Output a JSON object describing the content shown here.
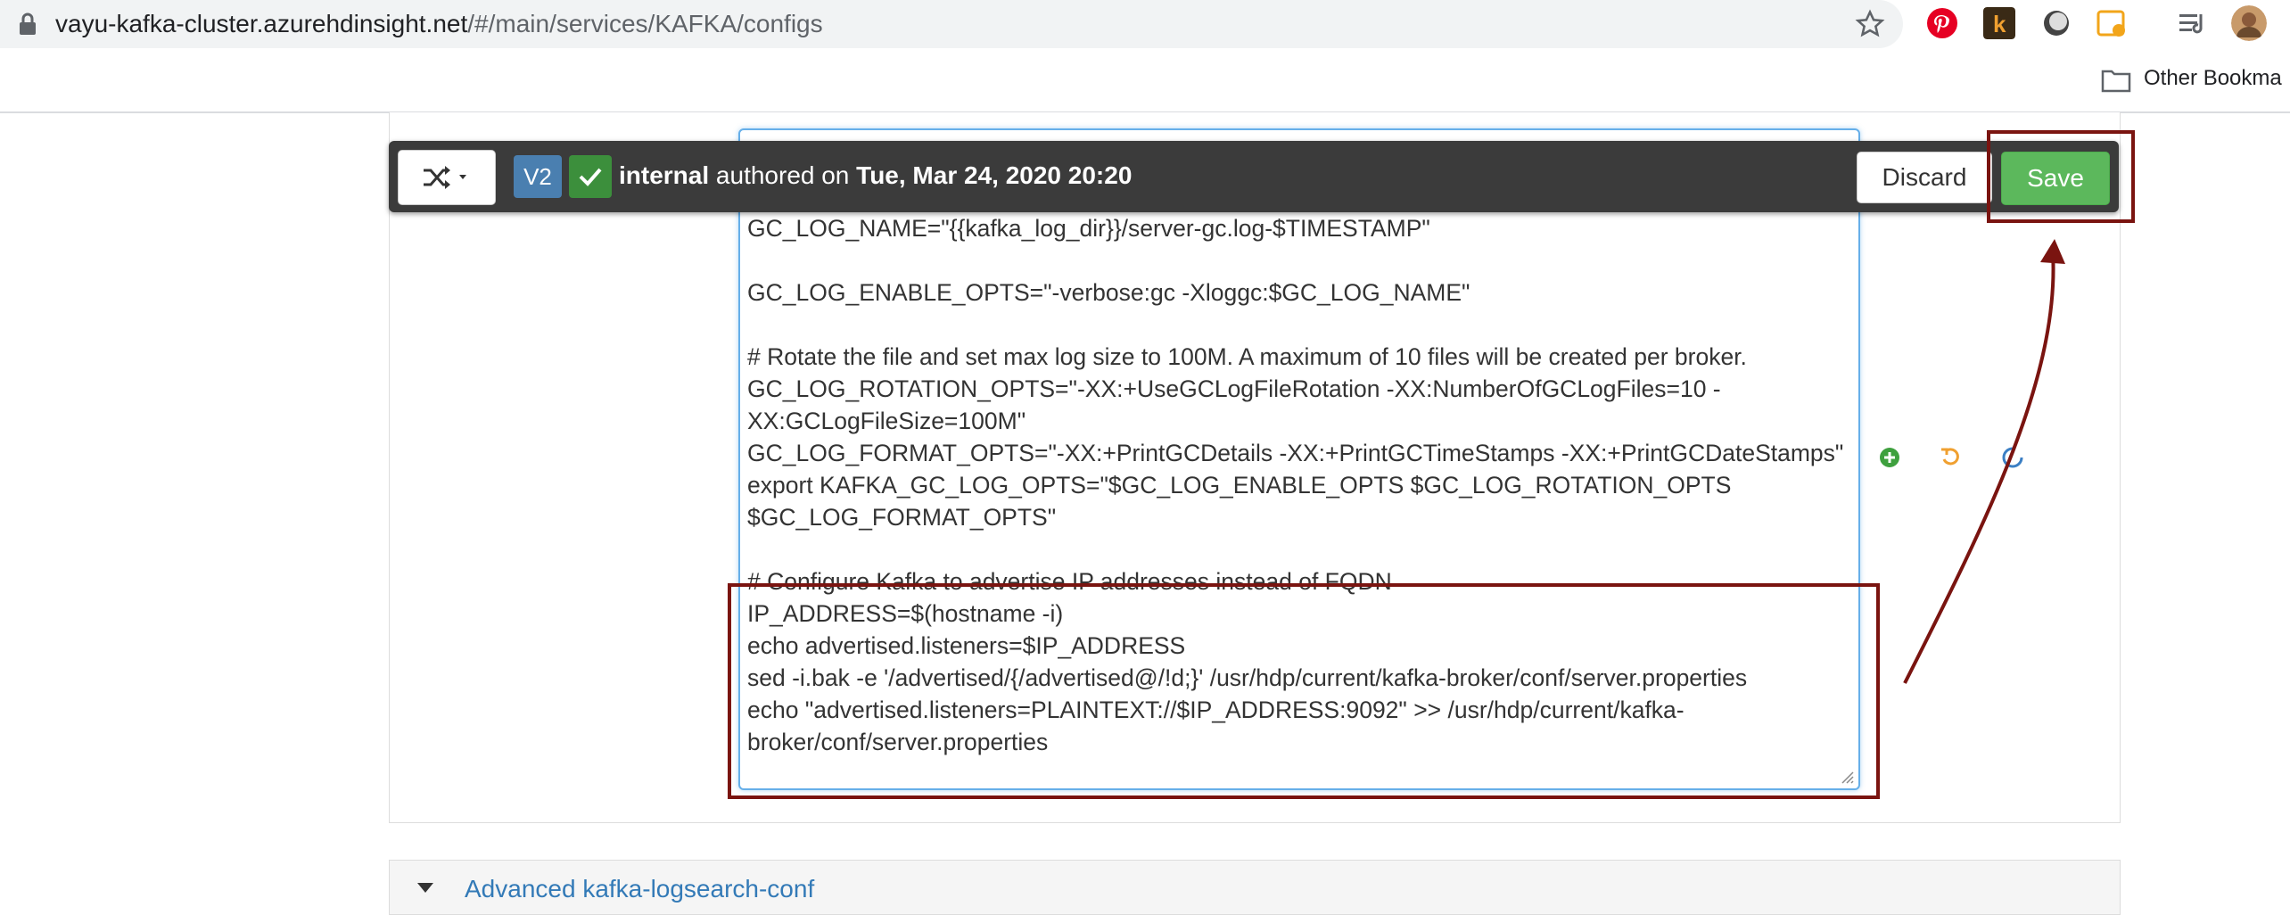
{
  "browser": {
    "url_host": "vayu-kafka-cluster.azurehdinsight.net",
    "url_path": "/#/main/services/KAFKA/configs",
    "bookmark_folder": "Other Bookma"
  },
  "toolbar": {
    "version_badge": "V2",
    "author": "internal",
    "authored_text": "authored on",
    "date": "Tue, Mar 24, 2020 20:20",
    "discard_label": "Discard",
    "save_label": "Save"
  },
  "editor": {
    "lines": [
      "GC_LOG_NAME=\"{{kafka_log_dir}}/server-gc.log-$TIMESTAMP\"",
      "",
      "GC_LOG_ENABLE_OPTS=\"-verbose:gc -Xloggc:$GC_LOG_NAME\"",
      "",
      "# Rotate the file and set max log size to 100M. A maximum of 10 files will be created per broker.",
      "GC_LOG_ROTATION_OPTS=\"-XX:+UseGCLogFileRotation -XX:NumberOfGCLogFiles=10 -XX:GCLogFileSize=100M\"",
      "GC_LOG_FORMAT_OPTS=\"-XX:+PrintGCDetails -XX:+PrintGCTimeStamps -XX:+PrintGCDateStamps\"",
      "export KAFKA_GC_LOG_OPTS=\"$GC_LOG_ENABLE_OPTS $GC_LOG_ROTATION_OPTS $GC_LOG_FORMAT_OPTS\"",
      "",
      "# Configure Kafka to advertise IP addresses instead of FQDN",
      "IP_ADDRESS=$(hostname -i)",
      "echo advertised.listeners=$IP_ADDRESS",
      "sed -i.bak -e '/advertised/{/advertised@/!d;}' /usr/hdp/current/kafka-broker/conf/server.properties",
      "echo \"advertised.listeners=PLAINTEXT://$IP_ADDRESS:9092\" >> /usr/hdp/current/kafka-broker/conf/server.properties"
    ]
  },
  "next_section": {
    "title": "Advanced kafka-logsearch-conf"
  },
  "colors": {
    "save_green": "#5cb85c",
    "annotation_red": "#7a1410",
    "toolbar_bg": "#3b3b3b",
    "badge_blue": "#4a7fb0"
  }
}
